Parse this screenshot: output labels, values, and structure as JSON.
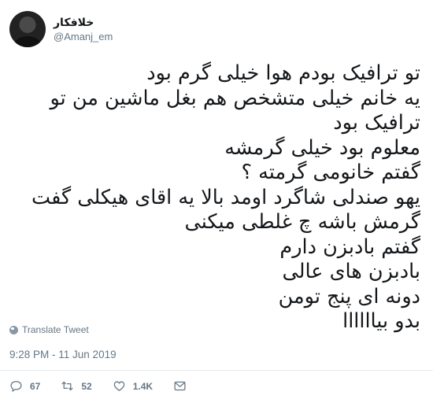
{
  "author": {
    "display_name": "خلافکار",
    "handle": "@Amanj_em"
  },
  "tweet": {
    "lines": [
      "تو ترافیک بودم هوا خیلی گرم بود",
      "یه خانم خیلی متشخص هم بغل ماشین من تو",
      "ترافیک بود",
      "معلوم بود خیلی گرمشه",
      "گفتم خانومی گرمته ؟",
      "یهو صندلی شاگرد اومد بالا یه اقای هیکلی گفت",
      "گرمش باشه چ غلطی میکنی",
      "گفتم بادبزن دارم",
      "بادبزن های عالی",
      "دونه ای پنج تومن",
      "بدو بیاااااا"
    ],
    "translate_label": "Translate Tweet",
    "timestamp": "9:28 PM - 11 Jun 2019"
  },
  "actions": {
    "replies": "67",
    "retweets": "52",
    "likes": "1.4K"
  },
  "icons": [
    "reply-icon",
    "retweet-icon",
    "like-icon",
    "message-icon",
    "globe-icon"
  ],
  "colors": {
    "text": "#14171a",
    "muted": "#657786",
    "divider": "#e6ecf0"
  }
}
